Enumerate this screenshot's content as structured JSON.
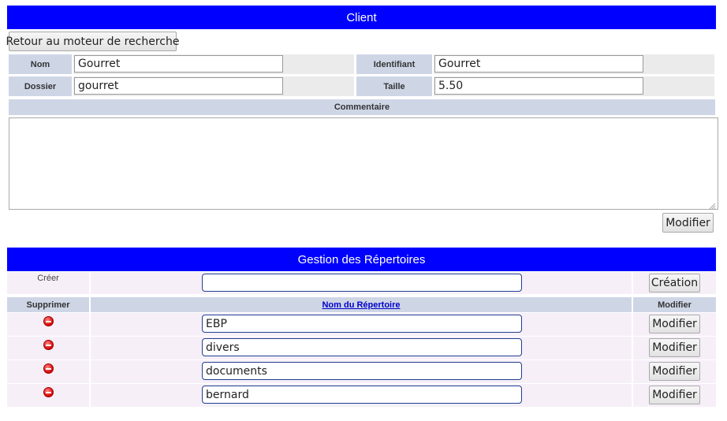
{
  "client": {
    "title": "Client",
    "back_button": "Retour au moteur de recherche",
    "fields": {
      "nom_label": "Nom",
      "nom_value": "Gourret",
      "identifiant_label": "Identifiant",
      "identifiant_value": "Gourret",
      "dossier_label": "Dossier",
      "dossier_value": "gourret",
      "taille_label": "Taille",
      "taille_value": "5.50"
    },
    "commentaire_label": "Commentaire",
    "commentaire_value": "",
    "modify_button": "Modifier"
  },
  "repertoires": {
    "title": "Gestion des Répertoires",
    "create_label": "Créer",
    "create_value": "",
    "create_button": "Création",
    "headers": {
      "delete": "Supprimer",
      "name": "Nom du Répertoire",
      "modify": "Modifier"
    },
    "rows": [
      {
        "name": "EBP",
        "modify": "Modifier"
      },
      {
        "name": "divers",
        "modify": "Modifier"
      },
      {
        "name": "documents",
        "modify": "Modifier"
      },
      {
        "name": "bernard",
        "modify": "Modifier"
      }
    ]
  },
  "icons": {
    "delete": "delete-icon"
  }
}
